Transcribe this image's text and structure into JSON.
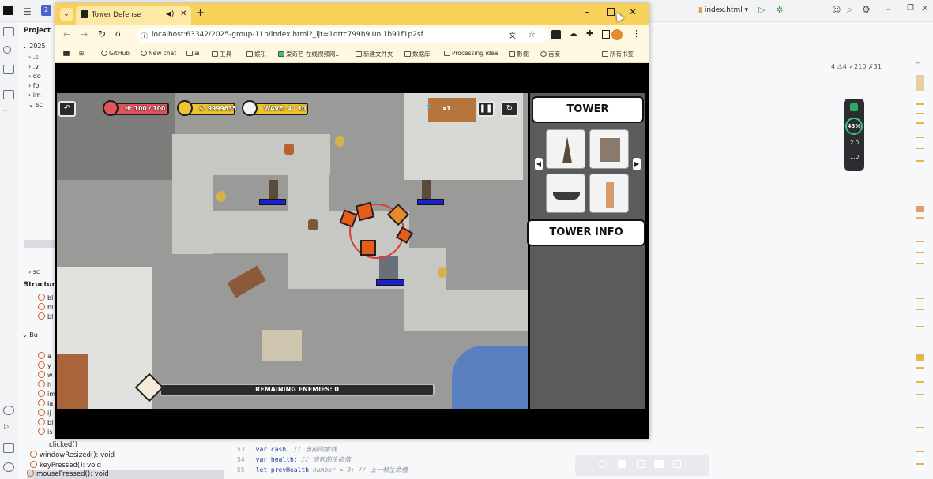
{
  "ide": {
    "project_label": "Project",
    "project_root": "2025",
    "structure_label": "Structure",
    "file_tab": "index.html",
    "stats": "4  ⚠4  ✓210  ✗31",
    "perf": {
      "percent": "43%",
      "up": "2.0",
      "down": "1.0"
    },
    "structure_items": [
      "clicked()",
      "windowResized(): void",
      "keyPressed(): void",
      "mousePressed(): void"
    ],
    "structure_short": [
      "bl",
      "bl",
      "bl",
      "Bu",
      "a",
      "y",
      "w",
      "h",
      "im",
      "la",
      "ij",
      "bl",
      "is"
    ],
    "code": [
      {
        "ln": "53",
        "kw": "var cash;",
        "cm": "// 当前的金钱"
      },
      {
        "ln": "54",
        "kw": "var health;",
        "cm": "// 当前的生命值"
      },
      {
        "ln": "55",
        "kw": "let prevHealth",
        "cm": "number  = 0;  // 上一帧生命值"
      }
    ]
  },
  "browser": {
    "tab_title": "Tower Defense",
    "url": "localhost:63342/2025-group-11b/index.html?_ijt=1dttc799b9l0nl1b91f1p2sf",
    "bookmarks": [
      "GitHub",
      "New chat",
      "ai",
      "工具",
      "娱乐",
      "爱奇艺 在线视频网...",
      "新建文件夹",
      "数据库",
      "Processing idea",
      "影视",
      "百度",
      "所有书签"
    ]
  },
  "game": {
    "hp": "H: 100 / 100",
    "cash": "$: 9999635",
    "wave": "WAVE: 4 / 10",
    "speed": "x1",
    "remaining": "REMAINING ENEMIES: 0",
    "panel_tower": "TOWER",
    "panel_info": "TOWER INFO",
    "tower_cards": [
      "tower-1",
      "tower-2",
      "tower-3",
      "tower-4"
    ]
  }
}
